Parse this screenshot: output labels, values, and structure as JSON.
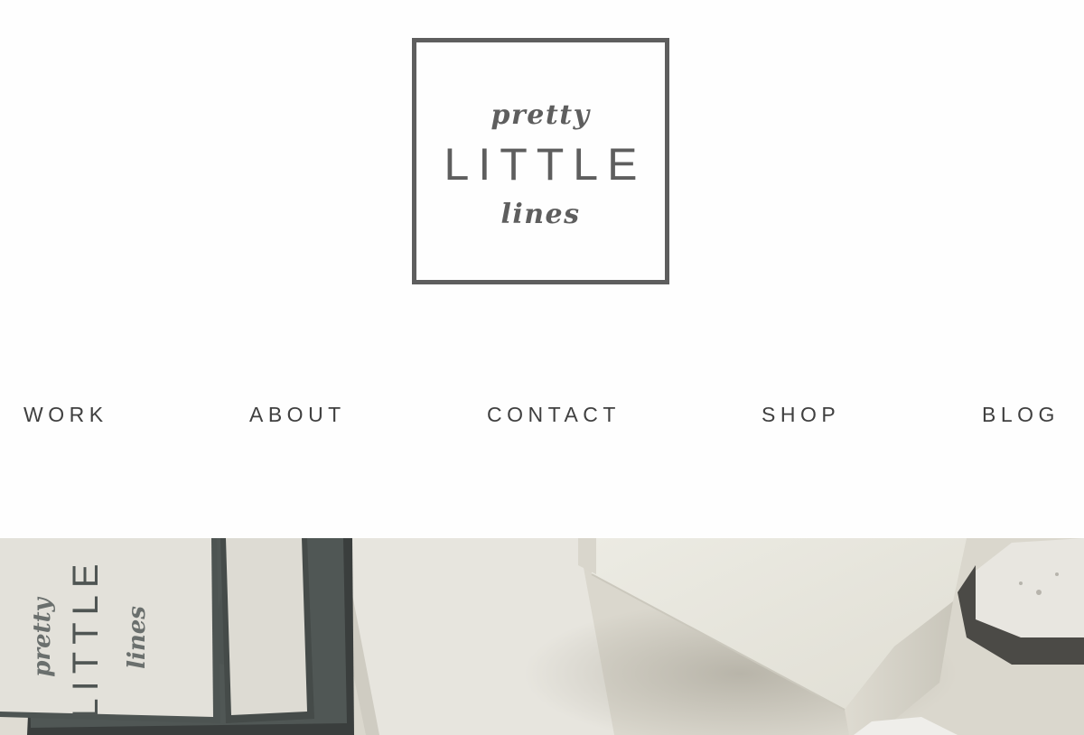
{
  "logo": {
    "top": "pretty",
    "middle": "LITTLE",
    "bottom": "lines"
  },
  "nav": {
    "items": [
      {
        "label": "WORK"
      },
      {
        "label": "ABOUT"
      },
      {
        "label": "CONTACT"
      },
      {
        "label": "SHOP"
      },
      {
        "label": "BLOG"
      }
    ]
  },
  "hero": {
    "card_text": [
      "pretty",
      "LITTLE",
      "lines"
    ]
  },
  "colors": {
    "logo": "#5e5e5e",
    "nav_text": "#3f3f3f",
    "background": "#fefefe",
    "card_edge": "#4d5452"
  }
}
